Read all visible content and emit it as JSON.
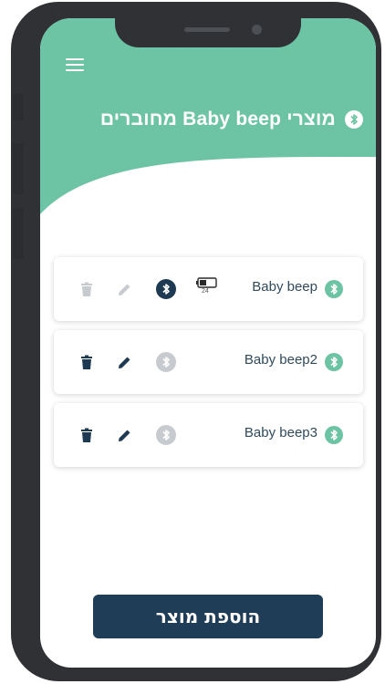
{
  "header": {
    "title": "מוצרי Baby beep מחוברים",
    "background_color": "#6cc4a4"
  },
  "devices": [
    {
      "name": "Baby beep",
      "connected": true,
      "battery": "24"
    },
    {
      "name": "Baby beep2",
      "connected": false
    },
    {
      "name": "Baby beep3",
      "connected": false
    }
  ],
  "add_button_label": "הוספת מוצר",
  "colors": {
    "accent_green": "#6cc4a4",
    "dark_navy": "#1f3d57",
    "disabled_grey": "#c7cbcf"
  },
  "icons": {
    "menu": "menu-icon",
    "bluetooth": "bluetooth-icon",
    "trash": "trash-icon",
    "edit": "pencil-icon",
    "battery": "battery-icon"
  }
}
